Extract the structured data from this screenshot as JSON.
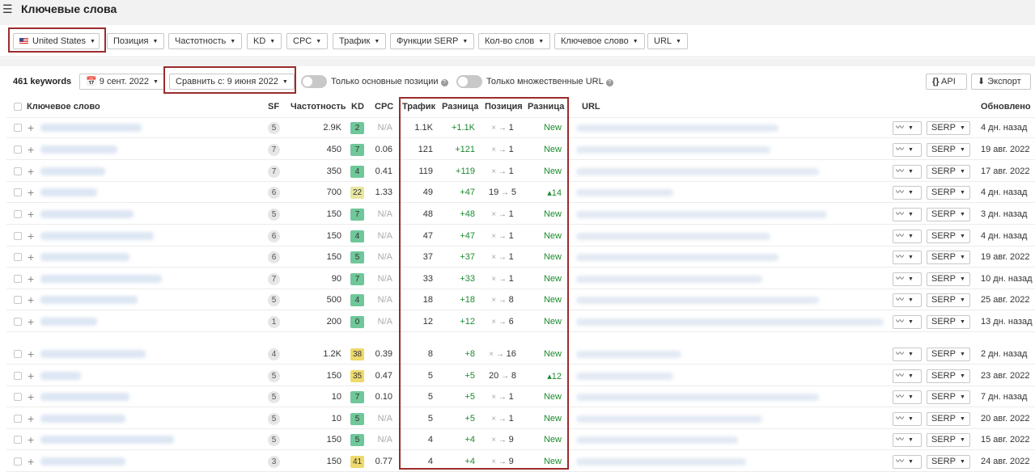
{
  "title": "Ключевые слова",
  "filters": [
    {
      "label": "United States",
      "icon": "us-flag-icon"
    },
    {
      "label": "Позиция"
    },
    {
      "label": "Частотность"
    },
    {
      "label": "KD"
    },
    {
      "label": "CPC"
    },
    {
      "label": "Трафик"
    },
    {
      "label": "Функции SERP"
    },
    {
      "label": "Кол-во слов"
    },
    {
      "label": "Ключевое слово"
    },
    {
      "label": "URL"
    }
  ],
  "toolbar": {
    "keyword_count": "461 keywords",
    "date": "9 сент. 2022",
    "compare": "Сравнить с: 9 июня 2022",
    "toggle1_label": "Только основные позиции",
    "toggle2_label": "Только множественные URL",
    "api_label": "API",
    "export_label": "Экспорт"
  },
  "columns": {
    "keyword": "Ключевое слово",
    "sf": "SF",
    "volume": "Частотность",
    "kd": "KD",
    "cpc": "CPC",
    "traffic": "Трафик",
    "traffic_diff": "Разница",
    "position": "Позиция",
    "position_diff": "Разница",
    "url": "URL",
    "updated": "Обновлено"
  },
  "serp_label": "SERP",
  "rows": [
    {
      "sf": "5",
      "volume": "2.9K",
      "kd": "2",
      "kd_color": "green",
      "cpc": "N/A",
      "traffic": "1.1K",
      "traffic_diff": "+1.1K",
      "pos_from": "×",
      "pos_to": "1",
      "pos_diff": "New",
      "updated": "4 дн. назад"
    },
    {
      "sf": "7",
      "volume": "450",
      "kd": "7",
      "kd_color": "green",
      "cpc": "0.06",
      "traffic": "121",
      "traffic_diff": "+121",
      "pos_from": "×",
      "pos_to": "1",
      "pos_diff": "New",
      "updated": "19 авг. 2022"
    },
    {
      "sf": "7",
      "volume": "350",
      "kd": "4",
      "kd_color": "green",
      "cpc": "0.41",
      "traffic": "119",
      "traffic_diff": "+119",
      "pos_from": "×",
      "pos_to": "1",
      "pos_diff": "New",
      "updated": "17 авг. 2022"
    },
    {
      "sf": "6",
      "volume": "700",
      "kd": "22",
      "kd_color": "ltyellow",
      "cpc": "1.33",
      "traffic": "49",
      "traffic_diff": "+47",
      "pos_from": "19",
      "pos_to": "5",
      "pos_diff": "▴14",
      "updated": "4 дн. назад"
    },
    {
      "sf": "5",
      "volume": "150",
      "kd": "7",
      "kd_color": "green",
      "cpc": "N/A",
      "traffic": "48",
      "traffic_diff": "+48",
      "pos_from": "×",
      "pos_to": "1",
      "pos_diff": "New",
      "updated": "3 дн. назад"
    },
    {
      "sf": "6",
      "volume": "150",
      "kd": "4",
      "kd_color": "green",
      "cpc": "N/A",
      "traffic": "47",
      "traffic_diff": "+47",
      "pos_from": "×",
      "pos_to": "1",
      "pos_diff": "New",
      "updated": "4 дн. назад"
    },
    {
      "sf": "6",
      "volume": "150",
      "kd": "5",
      "kd_color": "green",
      "cpc": "N/A",
      "traffic": "37",
      "traffic_diff": "+37",
      "pos_from": "×",
      "pos_to": "1",
      "pos_diff": "New",
      "updated": "19 авг. 2022"
    },
    {
      "sf": "7",
      "volume": "90",
      "kd": "7",
      "kd_color": "green",
      "cpc": "N/A",
      "traffic": "33",
      "traffic_diff": "+33",
      "pos_from": "×",
      "pos_to": "1",
      "pos_diff": "New",
      "updated": "10 дн. назад"
    },
    {
      "sf": "5",
      "volume": "500",
      "kd": "4",
      "kd_color": "green",
      "cpc": "N/A",
      "traffic": "18",
      "traffic_diff": "+18",
      "pos_from": "×",
      "pos_to": "8",
      "pos_diff": "New",
      "updated": "25 авг. 2022"
    },
    {
      "sf": "1",
      "volume": "200",
      "kd": "0",
      "kd_color": "green",
      "cpc": "N/A",
      "traffic": "12",
      "traffic_diff": "+12",
      "pos_from": "×",
      "pos_to": "6",
      "pos_diff": "New",
      "updated": "13 дн. назад"
    },
    {
      "sf": "4",
      "volume": "1.2K",
      "kd": "38",
      "kd_color": "yellow",
      "cpc": "0.39",
      "traffic": "8",
      "traffic_diff": "+8",
      "pos_from": "×",
      "pos_to": "16",
      "pos_diff": "New",
      "updated": "2 дн. назад"
    },
    {
      "sf": "5",
      "volume": "150",
      "kd": "35",
      "kd_color": "yellow",
      "cpc": "0.47",
      "traffic": "5",
      "traffic_diff": "+5",
      "pos_from": "20",
      "pos_to": "8",
      "pos_diff": "▴12",
      "updated": "23 авг. 2022"
    },
    {
      "sf": "5",
      "volume": "10",
      "kd": "7",
      "kd_color": "green",
      "cpc": "0.10",
      "traffic": "5",
      "traffic_diff": "+5",
      "pos_from": "×",
      "pos_to": "1",
      "pos_diff": "New",
      "updated": "7 дн. назад"
    },
    {
      "sf": "5",
      "volume": "10",
      "kd": "5",
      "kd_color": "green",
      "cpc": "N/A",
      "traffic": "5",
      "traffic_diff": "+5",
      "pos_from": "×",
      "pos_to": "1",
      "pos_diff": "New",
      "updated": "20 авг. 2022"
    },
    {
      "sf": "5",
      "volume": "150",
      "kd": "5",
      "kd_color": "green",
      "cpc": "N/A",
      "traffic": "4",
      "traffic_diff": "+4",
      "pos_from": "×",
      "pos_to": "9",
      "pos_diff": "New",
      "updated": "15 авг. 2022"
    },
    {
      "sf": "3",
      "volume": "150",
      "kd": "41",
      "kd_color": "yellow",
      "cpc": "0.77",
      "traffic": "4",
      "traffic_diff": "+4",
      "pos_from": "×",
      "pos_to": "9",
      "pos_diff": "New",
      "updated": "24 авг. 2022"
    }
  ],
  "colors": {
    "highlight": "#9b2c2c",
    "kd_green": "#6fc79a",
    "kd_yellow": "#eed96d",
    "positive": "#1b8a2e"
  }
}
